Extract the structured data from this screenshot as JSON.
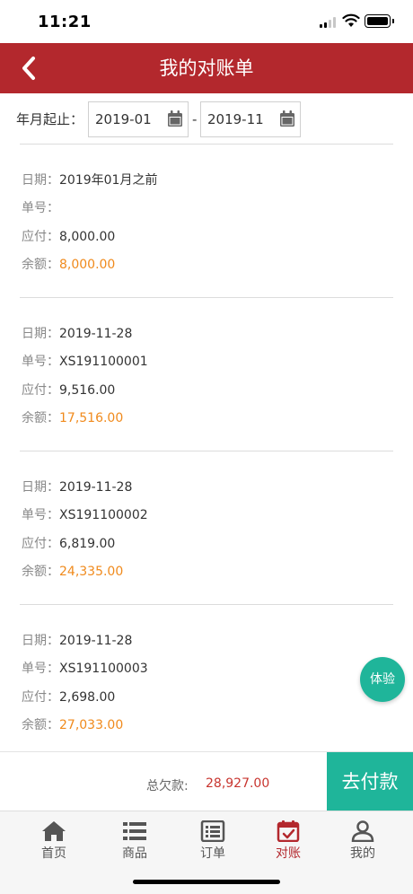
{
  "status_bar": {
    "time": "11:21"
  },
  "nav": {
    "title": "我的对账单"
  },
  "filter": {
    "label": "年月起止：",
    "start": "2019-01",
    "separator": "-",
    "end": "2019-11"
  },
  "labels": {
    "date": "日期：",
    "order_no": "单号：",
    "payable": "应付：",
    "balance": "余额："
  },
  "records": [
    {
      "date": "2019年01月之前",
      "order_no": "",
      "payable": "8,000.00",
      "balance": "8,000.00"
    },
    {
      "date": "2019-11-28",
      "order_no": "XS191100001",
      "payable": "9,516.00",
      "balance": "17,516.00"
    },
    {
      "date": "2019-11-28",
      "order_no": "XS191100002",
      "payable": "6,819.00",
      "balance": "24,335.00"
    },
    {
      "date": "2019-11-28",
      "order_no": "XS191100003",
      "payable": "2,698.00",
      "balance": "27,033.00"
    }
  ],
  "experience_button": "体验",
  "total": {
    "label": "总欠款:",
    "value": "28,927.00"
  },
  "pay_button": "去付款",
  "tabs": [
    {
      "label": "首页",
      "icon": "home-icon"
    },
    {
      "label": "商品",
      "icon": "list-icon"
    },
    {
      "label": "订单",
      "icon": "order-icon"
    },
    {
      "label": "对账",
      "icon": "calendar-check-icon",
      "active": true
    },
    {
      "label": "我的",
      "icon": "user-icon"
    }
  ],
  "colors": {
    "brand": "#b3282d",
    "accent": "#1fb59a",
    "balance": "#f08a1c",
    "debt": "#c8352f"
  }
}
